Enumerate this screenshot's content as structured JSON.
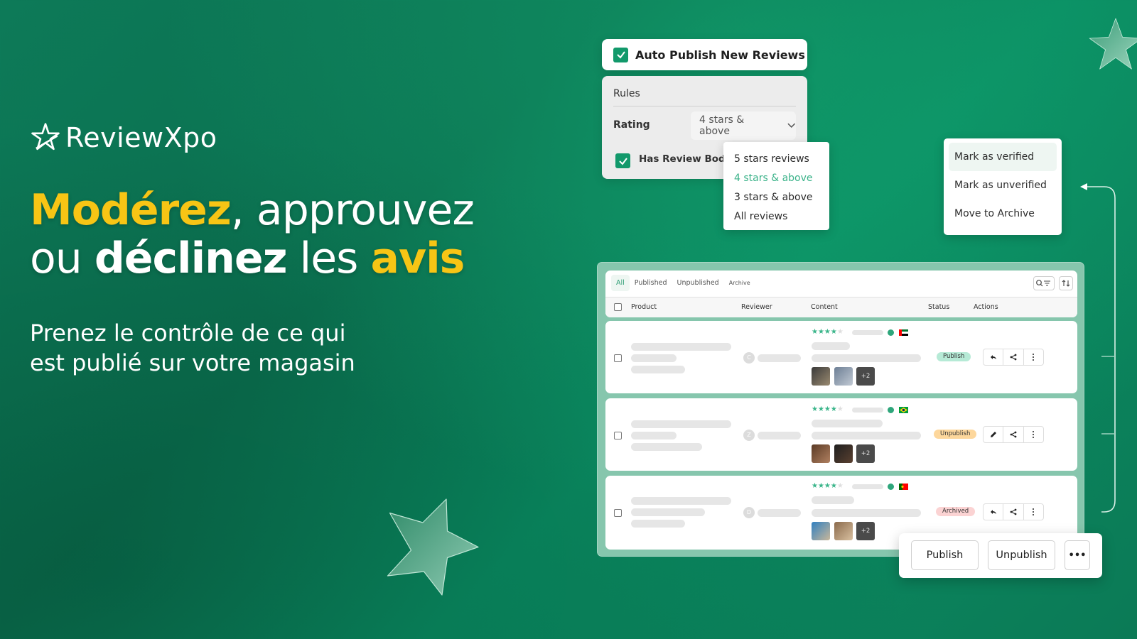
{
  "brand": {
    "name": "ReviewXpo",
    "logo_icon": "star-arrow-icon"
  },
  "hero": {
    "line1_highlight": "Modérez",
    "line1_rest": ", approuvez",
    "line2_a": "ou ",
    "line2_bold": "déclinez",
    "line2_b": " les ",
    "line2_highlight": "avis",
    "subtitle_line1": "Prenez le contrôle de ce qui",
    "subtitle_line2": "est publié sur votre magasin"
  },
  "colors": {
    "accent_yellow": "#f7c515",
    "brand_green": "#12996b",
    "bg_green": "#0b7a56"
  },
  "auto_publish": {
    "checked": true,
    "label": "Auto Publish New Reviews",
    "rules_title": "Rules",
    "rating_label": "Rating",
    "rating_value": "4 stars & above",
    "has_body_checked": true,
    "has_body_label": "Has Review Body"
  },
  "rating_menu": {
    "options": [
      "5 stars reviews",
      "4 stars & above",
      "3 stars & above",
      "All reviews"
    ],
    "selected": "4 stars & above"
  },
  "verify_menu": {
    "options": [
      "Mark as verified",
      "Mark as unverified",
      "Move to Archive"
    ],
    "highlighted": "Mark as verified"
  },
  "table": {
    "tabs": [
      "All",
      "Published",
      "Unpublished",
      "Archive"
    ],
    "active_tab": "All",
    "columns": [
      "Product",
      "Reviewer",
      "Content",
      "Status",
      "Actions"
    ],
    "rows": [
      {
        "avatar_initial": "C",
        "rating": 4,
        "verified": true,
        "country_flag": "UAE",
        "images_more": "+2",
        "status": "Publish",
        "actions": [
          "reply-icon",
          "share-icon",
          "more-vertical-icon"
        ]
      },
      {
        "avatar_initial": "Z",
        "rating": 4,
        "verified": true,
        "country_flag": "Brazil",
        "images_more": "+2",
        "status": "Unpublish",
        "actions": [
          "edit-icon",
          "share-icon",
          "more-vertical-icon"
        ]
      },
      {
        "avatar_initial": "D",
        "rating": 4,
        "verified": true,
        "country_flag": "Portugal",
        "images_more": "+2",
        "status": "Archived",
        "actions": [
          "reply-icon",
          "share-icon",
          "more-vertical-icon"
        ]
      }
    ]
  },
  "bulk_actions": {
    "publish": "Publish",
    "unpublish": "Unpublish",
    "more": "•••"
  }
}
